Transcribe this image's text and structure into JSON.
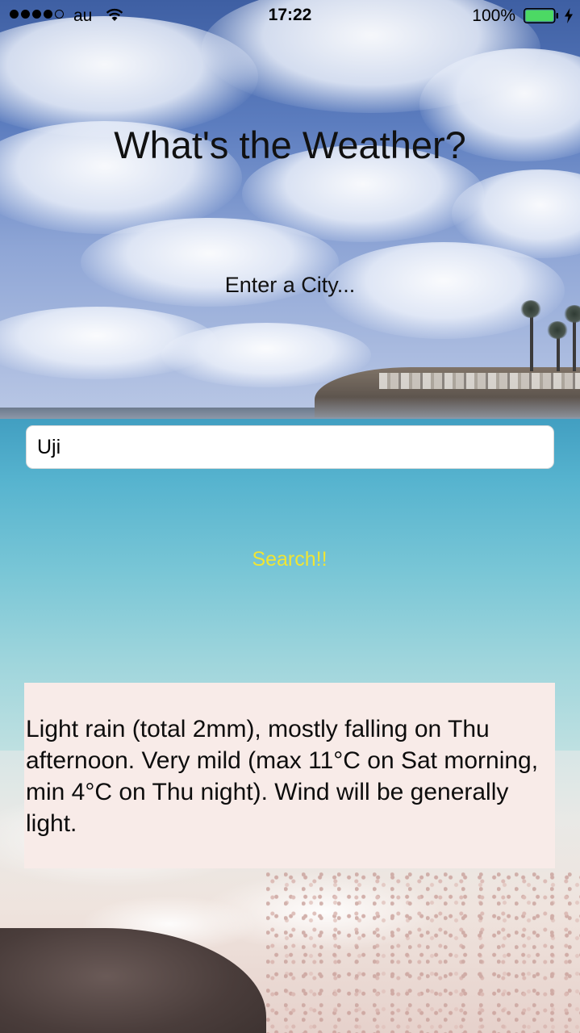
{
  "status_bar": {
    "signal_bars_filled": 4,
    "signal_bars_total": 5,
    "carrier": "au",
    "time": "17:22",
    "battery_percent": "100%",
    "battery_level": 1.0,
    "icons": [
      "signal-dots-icon",
      "wifi-icon",
      "battery-icon",
      "charging-bolt-icon"
    ]
  },
  "app": {
    "title": "What's the Weather?",
    "prompt": "Enter a City...",
    "city_input_value": "Uji",
    "search_label": "Search!!",
    "forecast_text": "Light rain (total 2mm), mostly falling on Thu afternoon. Very mild (max 11°C on Sat morning, min 4°C on Thu night). Wind will be generally light."
  },
  "colors": {
    "search_button": "#f0e534",
    "result_background": "#f8ebe8",
    "battery_fill": "#4cd964"
  }
}
